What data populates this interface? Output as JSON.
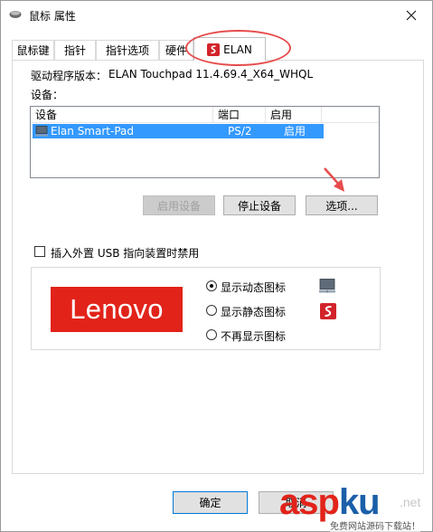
{
  "window": {
    "title": "鼠标 属性"
  },
  "tabs": [
    {
      "label": "鼠标键"
    },
    {
      "label": "指针"
    },
    {
      "label": "指针选项"
    },
    {
      "label": "硬件"
    },
    {
      "label": "ELAN",
      "active": true
    }
  ],
  "driver": {
    "label": "驱动程序版本：",
    "value": "ELAN Touchpad 11.4.69.4_X64_WHQL"
  },
  "devices": {
    "label": "设备：",
    "columns": [
      "设备",
      "端口",
      "启用"
    ],
    "rows": [
      {
        "device": "Elan Smart-Pad",
        "port": "PS/2",
        "enabled": "启用",
        "selected": true
      }
    ]
  },
  "buttons": {
    "enable_device": "启用设备",
    "stop_device": "停止设备",
    "options": "选项...",
    "ok": "确定",
    "cancel": "取消"
  },
  "usb_disable": {
    "label": "插入外置 USB 指向装置时禁用",
    "checked": false
  },
  "tray_icon": {
    "options": [
      {
        "label": "显示动态图标",
        "checked": true
      },
      {
        "label": "显示静态图标",
        "checked": false
      },
      {
        "label": "不再显示图标",
        "checked": false
      }
    ]
  },
  "branding": {
    "logo_text": "Lenovo",
    "brand_color": "#e2231a"
  },
  "watermark": {
    "main_a": "asp",
    "main_b": "ku",
    "tld": ".net",
    "subtitle": "免费网站源码下载站！"
  },
  "colors": {
    "selection": "#3399ff",
    "annotation": "#e74c4c"
  }
}
